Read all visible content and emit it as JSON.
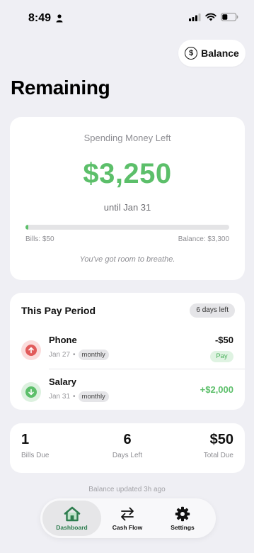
{
  "status_bar": {
    "time": "8:49"
  },
  "header": {
    "balance_button_label": "Balance",
    "title": "Remaining"
  },
  "spending": {
    "label": "Spending Money Left",
    "amount": "$3,250",
    "until": "until Jan 31",
    "progress_fraction": 0.015,
    "bills_caption": "Bills: $50",
    "balance_caption": "Balance: $3,300",
    "message": "You've got room to breathe."
  },
  "pay_period": {
    "title": "This Pay Period",
    "days_left_badge": "6 days left",
    "transactions": [
      {
        "name": "Phone",
        "date": "Jan 27",
        "separator": "•",
        "frequency": "monthly",
        "amount": "-$50",
        "action": "Pay",
        "type": "bill"
      },
      {
        "name": "Salary",
        "date": "Jan 31",
        "separator": "•",
        "frequency": "monthly",
        "amount": "+$2,000",
        "type": "income"
      }
    ]
  },
  "stats": [
    {
      "value": "1",
      "label": "Bills Due"
    },
    {
      "value": "6",
      "label": "Days Left"
    },
    {
      "value": "$50",
      "label": "Total Due"
    }
  ],
  "footer_note": "Balance updated 3h ago",
  "tab_bar": {
    "tabs": [
      {
        "label": "Dashboard",
        "icon": "house-icon",
        "active": true
      },
      {
        "label": "Cash Flow",
        "icon": "arrows-swap-icon",
        "active": false
      },
      {
        "label": "Settings",
        "icon": "gear-icon",
        "active": false
      }
    ]
  },
  "colors": {
    "positive_green": "#5cbf6a",
    "bill_red": "#e15b5b",
    "active_tab_green": "#2e7d4f",
    "background": "#efeff4"
  }
}
